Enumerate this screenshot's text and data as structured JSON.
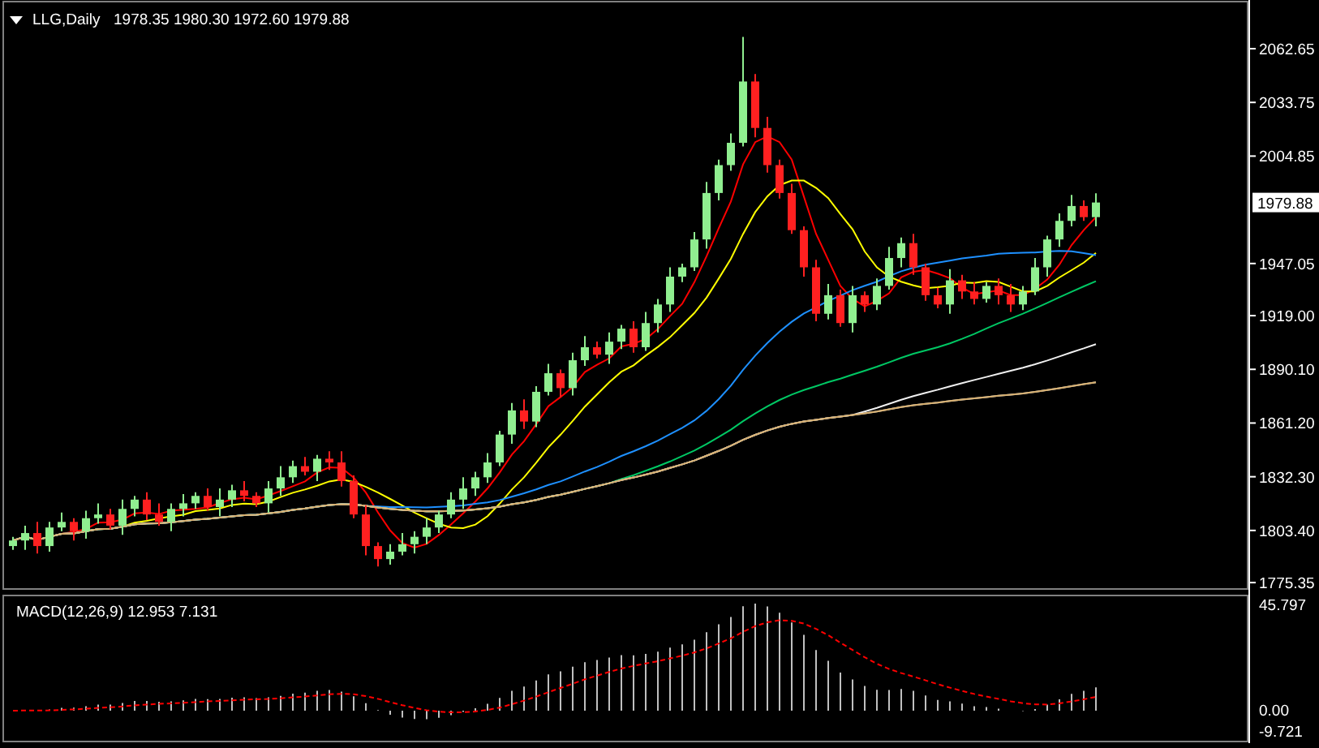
{
  "price_chart": {
    "symbol": "LLG,Daily",
    "ohlc": "1978.35 1980.30 1972.60 1979.88",
    "current_price": "1979.88",
    "axis_labels": [
      "2062.65",
      "2033.75",
      "2004.85",
      "1947.05",
      "1919.00",
      "1890.10",
      "1861.20",
      "1832.30",
      "1803.40",
      "1775.35"
    ]
  },
  "macd_chart": {
    "label": "MACD(12,26,9) 12.953 7.131",
    "axis_labels": [
      "45.797",
      "0.00",
      "-9.721"
    ]
  }
}
